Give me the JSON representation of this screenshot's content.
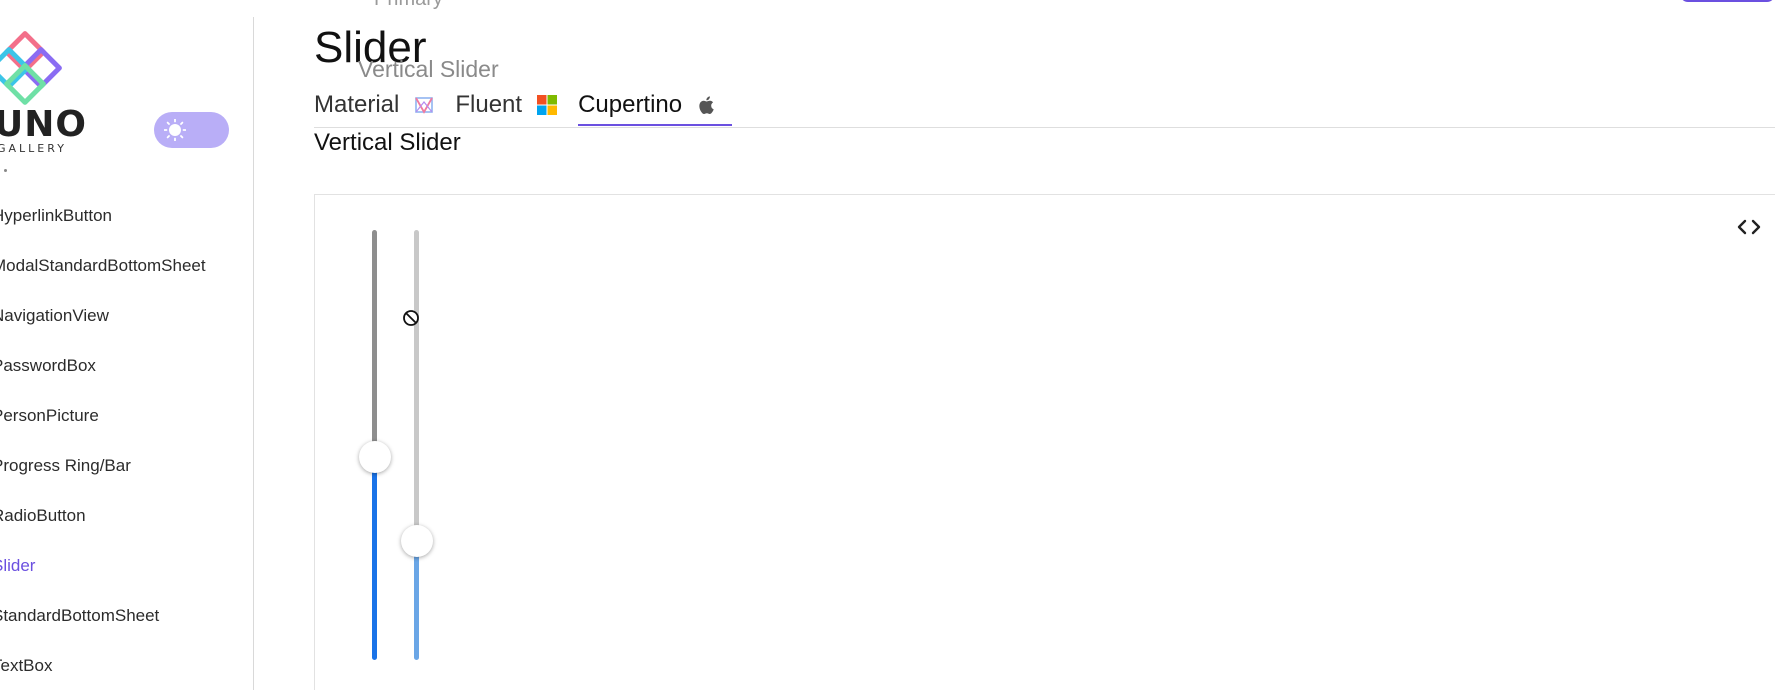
{
  "app": {
    "logo_word": "UNO",
    "logo_sub": "GALLERY"
  },
  "ghost": {
    "primary_label": "Primary",
    "subtitle": "Vertical Slider"
  },
  "sidebar": {
    "items": [
      {
        "label": "HyperlinkButton",
        "active": false
      },
      {
        "label": "ModalStandardBottomSheet",
        "active": false
      },
      {
        "label": "NavigationView",
        "active": false
      },
      {
        "label": "PasswordBox",
        "active": false
      },
      {
        "label": "PersonPicture",
        "active": false
      },
      {
        "label": "Progress Ring/Bar",
        "active": false
      },
      {
        "label": "RadioButton",
        "active": false
      },
      {
        "label": "Slider",
        "active": true
      },
      {
        "label": "StandardBottomSheet",
        "active": false
      },
      {
        "label": "TextBox",
        "active": false
      }
    ]
  },
  "page": {
    "title": "Slider",
    "section_title": "Vertical Slider"
  },
  "tabs": [
    {
      "label": "Material",
      "icon": "material-logo-icon",
      "active": false
    },
    {
      "label": "Fluent",
      "icon": "windows-logo-icon",
      "active": false
    },
    {
      "label": "Cupertino",
      "icon": "apple-logo-icon",
      "active": true
    }
  ],
  "sliders": [
    {
      "name": "vertical-slider-1",
      "value_fraction": 0.47,
      "fill_color": "#1a73e8",
      "track_color": "#8e8e8e"
    },
    {
      "name": "vertical-slider-2",
      "value_fraction": 0.26,
      "fill_color": "#6aa6e6",
      "track_color": "#c8c8c8"
    }
  ],
  "colors": {
    "accent": "#6b50e0",
    "toggle_bg": "#b9aef7"
  }
}
